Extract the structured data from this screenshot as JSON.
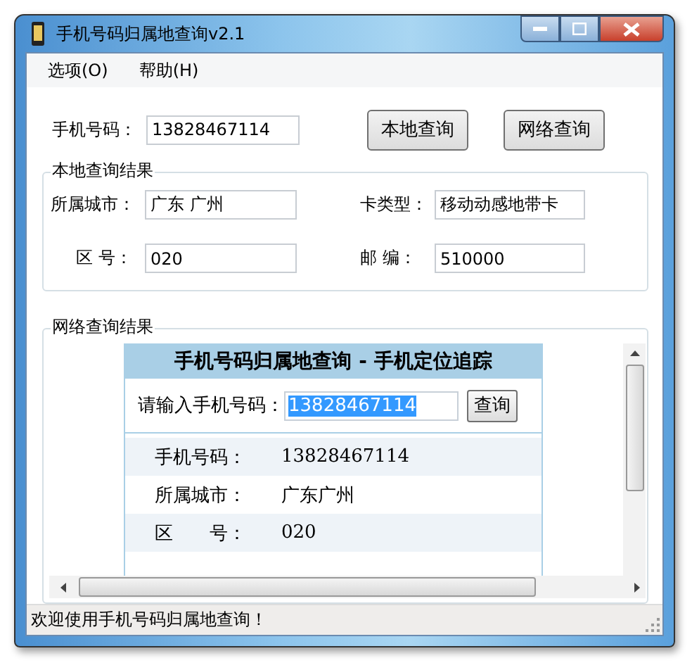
{
  "window": {
    "title": "手机号码归属地查询v2.1"
  },
  "menu": [
    {
      "label": "选项(O)"
    },
    {
      "label": "帮助(H)"
    }
  ],
  "phone": {
    "label": "手机号码：",
    "value": "13828467114"
  },
  "buttons": [
    "本地查询",
    "网络查询"
  ],
  "local_result": {
    "title": "本地查询结果",
    "fields": [
      {
        "label": "所属城市：",
        "value": "广东 广州"
      },
      {
        "label": "卡类型：",
        "value": "移动动感地带卡"
      },
      {
        "label": "区 号：",
        "value": "020"
      },
      {
        "label": "邮 编：",
        "value": "510000"
      }
    ]
  },
  "web_result": {
    "title": "网络查询结果",
    "page": {
      "heading": "手机号码归属地查询 - 手机定位追踪",
      "prompt": "请输入手机号码：",
      "input_value": "13828467114",
      "text_selected": true,
      "button": "查询",
      "rows": [
        {
          "label": "手机号码：",
          "value": "13828467114"
        },
        {
          "label": "所属城市：",
          "value": "广东广州"
        },
        {
          "label": "区　　号：",
          "value": "020"
        }
      ]
    }
  },
  "status_bar": "欢迎使用手机号码归属地查询！"
}
